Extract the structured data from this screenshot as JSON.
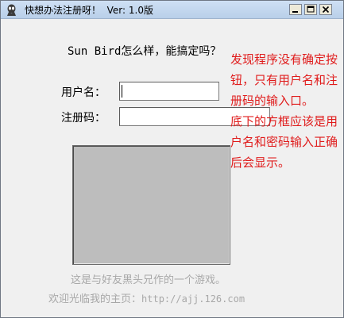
{
  "window": {
    "title": "快想办法注册呀！  Ver: 1.0版",
    "icon": "app-icon"
  },
  "titlebar_buttons": {
    "minimize": "minimize-icon",
    "maximize": "maximize-icon",
    "close": "close-icon"
  },
  "main": {
    "question": "Sun Bird怎么样，能搞定吗？",
    "username_label": "用户名：",
    "username_value": "",
    "regcode_label": "注册码：",
    "regcode_value": ""
  },
  "annotation": {
    "line1": "发现程序没有确定按钮，只有用户名和注册码的输入口。",
    "line2": "底下的方框应该是用户名和密码输入正确后会显示。",
    "color": "#e01c1c"
  },
  "footer": {
    "line1": "这是与好友黑头兄作的一个游戏。",
    "line2_prefix": "欢迎光临我的主页：",
    "url": "http://ajj.126.com"
  }
}
